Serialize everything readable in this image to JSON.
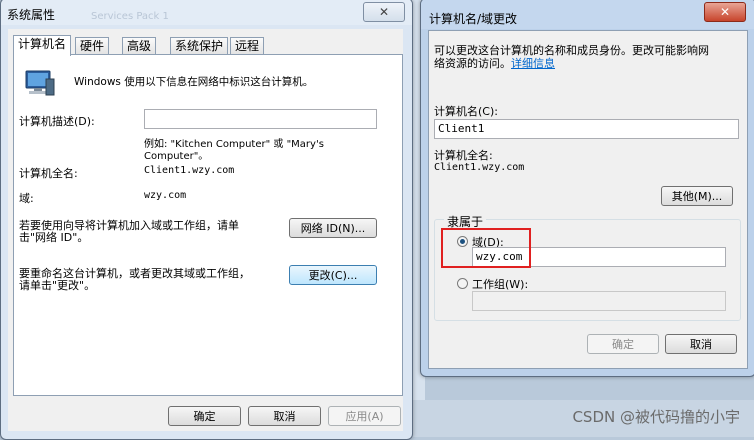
{
  "sysprops": {
    "title": "系统属性",
    "close": "✕",
    "tabs": [
      "计算机名",
      "硬件",
      "高级",
      "系统保护",
      "远程"
    ],
    "intro": "Windows 使用以下信息在网络中标识这台计算机。",
    "desc_label": "计算机描述(D):",
    "desc_value": "",
    "example": "例如: \"Kitchen Computer\" 或 \"Mary's",
    "example2": "Computer\"。",
    "fullname_label": "计算机全名:",
    "fullname_value": "Client1.wzy.com",
    "domain_label": "域:",
    "domain_value": "wzy.com",
    "netid_text1": "若要使用向导将计算机加入域或工作组，请单",
    "netid_text2": "击\"网络 ID\"。",
    "netid_button": "网络 ID(N)...",
    "rename_text1": "要重命名这台计算机，或者更改其域或工作组，",
    "rename_text2": "请单击\"更改\"。",
    "change_button": "更改(C)...",
    "ok": "确定",
    "cancel": "取消",
    "apply": "应用(A)"
  },
  "dialog": {
    "title": "计算机名/域更改",
    "close": "✕",
    "intro1": "可以更改这台计算机的名称和成员身份。更改可能影响网",
    "intro2": "络资源的访问。",
    "details_link": "详细信息",
    "name_label": "计算机名(C):",
    "name_value": "Client1",
    "fullname_label": "计算机全名:",
    "fullname_value": "Client1.wzy.com",
    "more_button": "其他(M)...",
    "member_of": "隶属于",
    "domain_radio": "域(D):",
    "domain_value": "wzy.com",
    "workgroup_radio": "工作组(W):",
    "workgroup_value": "",
    "ok": "确定",
    "cancel": "取消"
  },
  "background": {
    "faded_text": "Services Pack 1"
  },
  "watermark": "CSDN @被代码撸的小宇"
}
